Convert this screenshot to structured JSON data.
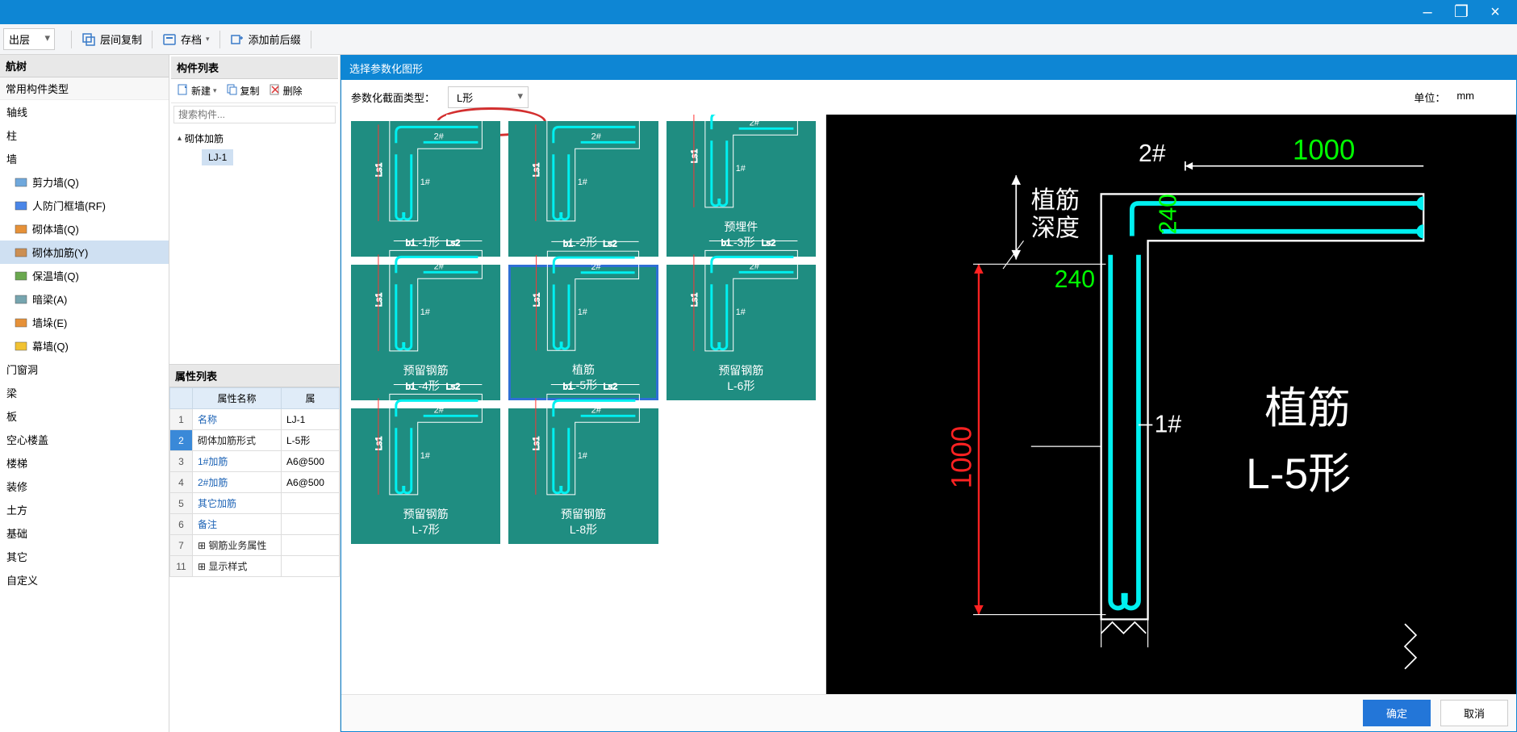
{
  "titlebar": {
    "minimize": "–",
    "maximize": "❐",
    "close": "×"
  },
  "toolbar": {
    "layer_dropdown": "出层",
    "copy_layers": "层间复制",
    "archive": "存档",
    "add_prefix": "添加前后缀"
  },
  "nav_tree": {
    "header": "航树",
    "subheader": "常用构件类型",
    "items": [
      {
        "label": "轴线",
        "k": "axis"
      },
      {
        "label": "柱",
        "k": "column"
      },
      {
        "label": "墙",
        "k": "wall"
      },
      {
        "label": "剪力墙(Q)",
        "k": "shearwall",
        "level2": true,
        "ico": "shearwall-icon"
      },
      {
        "label": "人防门框墙(RF)",
        "k": "rf",
        "level2": true,
        "ico": "rfwall-icon"
      },
      {
        "label": "砌体墙(Q)",
        "k": "masonry",
        "level2": true,
        "ico": "masonry-icon"
      },
      {
        "label": "砌体加筋(Y)",
        "k": "masonry-reinf",
        "level2": true,
        "ico": "reinf-icon",
        "selected": true
      },
      {
        "label": "保温墙(Q)",
        "k": "insul",
        "level2": true,
        "ico": "insul-icon"
      },
      {
        "label": "暗梁(A)",
        "k": "hidden-beam",
        "level2": true,
        "ico": "hiddenbeam-icon"
      },
      {
        "label": "墙垛(E)",
        "k": "pier",
        "level2": true,
        "ico": "pier-icon"
      },
      {
        "label": "幕墙(Q)",
        "k": "curtain",
        "level2": true,
        "ico": "curtain-icon"
      },
      {
        "label": "门窗洞",
        "k": "door"
      },
      {
        "label": "梁",
        "k": "beam"
      },
      {
        "label": "板",
        "k": "slab"
      },
      {
        "label": "空心楼盖",
        "k": "hollow"
      },
      {
        "label": "楼梯",
        "k": "stair"
      },
      {
        "label": "装修",
        "k": "decor"
      },
      {
        "label": "土方",
        "k": "earth"
      },
      {
        "label": "基础",
        "k": "foundation"
      },
      {
        "label": "其它",
        "k": "other"
      },
      {
        "label": "自定义",
        "k": "custom"
      }
    ]
  },
  "comp_list": {
    "header": "构件列表",
    "new": "新建",
    "copy": "复制",
    "delete": "删除",
    "search_placeholder": "搜索构件...",
    "root": "砌体加筋",
    "child": "LJ-1"
  },
  "prop": {
    "header": "属性列表",
    "col1": "属性名称",
    "col2": "属",
    "rows": [
      {
        "n": "1",
        "label": "名称",
        "val": "LJ-1",
        "blue": true
      },
      {
        "n": "2",
        "label": "砌体加筋形式",
        "val": "L-5形",
        "black": true,
        "sel": true
      },
      {
        "n": "3",
        "label": "1#加筋",
        "val": "A6@500",
        "blue": true
      },
      {
        "n": "4",
        "label": "2#加筋",
        "val": "A6@500",
        "blue": true
      },
      {
        "n": "5",
        "label": "其它加筋",
        "val": "",
        "blue": true
      },
      {
        "n": "6",
        "label": "备注",
        "val": "",
        "blue": true
      },
      {
        "n": "7",
        "label": "⊞ 钢筋业务属性",
        "val": "",
        "black": true
      },
      {
        "n": "11",
        "label": "⊞ 显示样式",
        "val": "",
        "black": true
      }
    ]
  },
  "dialog": {
    "title": "选择参数化图形",
    "param_label": "参数化截面类型：",
    "param_value": "L形",
    "unit_label": "单位：",
    "unit_value": "mm",
    "thumbs": [
      {
        "n": "L-1形",
        "t": ""
      },
      {
        "n": "L-2形",
        "t": ""
      },
      {
        "n": "L-3形",
        "t": "预埋件"
      },
      {
        "n": "L-4形",
        "t": "预留钢筋"
      },
      {
        "n": "L-5形",
        "t": "植筋",
        "sel": true
      },
      {
        "n": "L-6形",
        "t": "预留钢筋"
      },
      {
        "n": "L-7形",
        "t": "预留钢筋"
      },
      {
        "n": "L-8形",
        "t": "预留钢筋"
      }
    ],
    "preview": {
      "top_num": "1000",
      "label2": "2#",
      "left_num": "1000",
      "w1": "240",
      "w2": "240",
      "zhijin": "植筋",
      "depth": "深度",
      "label1": "1#",
      "main_label": "植筋",
      "main_name": "L-5形"
    },
    "ok": "确定",
    "cancel": "取消"
  }
}
